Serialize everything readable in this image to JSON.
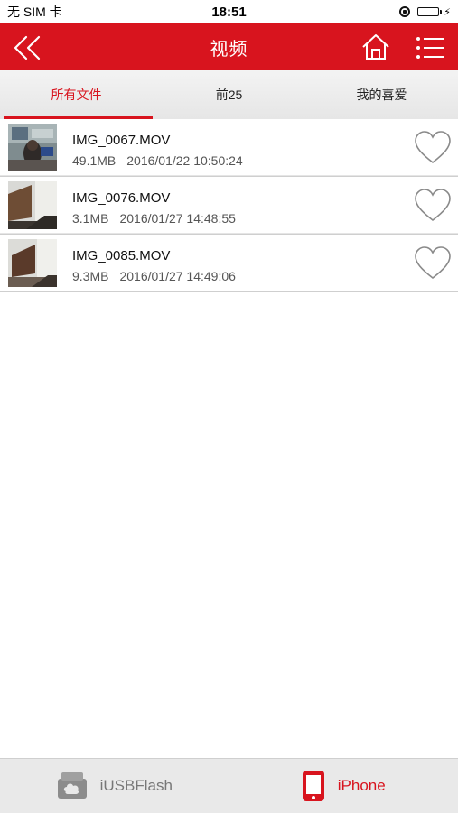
{
  "status_bar": {
    "carrier": "无 SIM 卡",
    "time": "18:51",
    "battery_percent": 100
  },
  "navbar": {
    "title": "视频",
    "back_icon": "double-chevron-left-icon",
    "home_icon": "home-icon",
    "menu_icon": "list-menu-icon"
  },
  "tabs": [
    {
      "label": "所有文件",
      "active": true
    },
    {
      "label": "前25",
      "active": false
    },
    {
      "label": "我的喜爱",
      "active": false
    }
  ],
  "files": [
    {
      "name": "IMG_0067.MOV",
      "size": "49.1MB",
      "date": "2016/01/22 10:50:24",
      "favorite": false
    },
    {
      "name": "IMG_0076.MOV",
      "size": "3.1MB",
      "date": "2016/01/27 14:48:55",
      "favorite": false
    },
    {
      "name": "IMG_0085.MOV",
      "size": "9.3MB",
      "date": "2016/01/27 14:49:06",
      "favorite": false
    }
  ],
  "bottom_tabs": [
    {
      "label": "iUSBFlash",
      "icon": "usb-drive-icon",
      "active": false
    },
    {
      "label": "iPhone",
      "icon": "phone-icon",
      "active": true
    }
  ],
  "colors": {
    "accent": "#d8141e",
    "battery": "#4cd964"
  }
}
